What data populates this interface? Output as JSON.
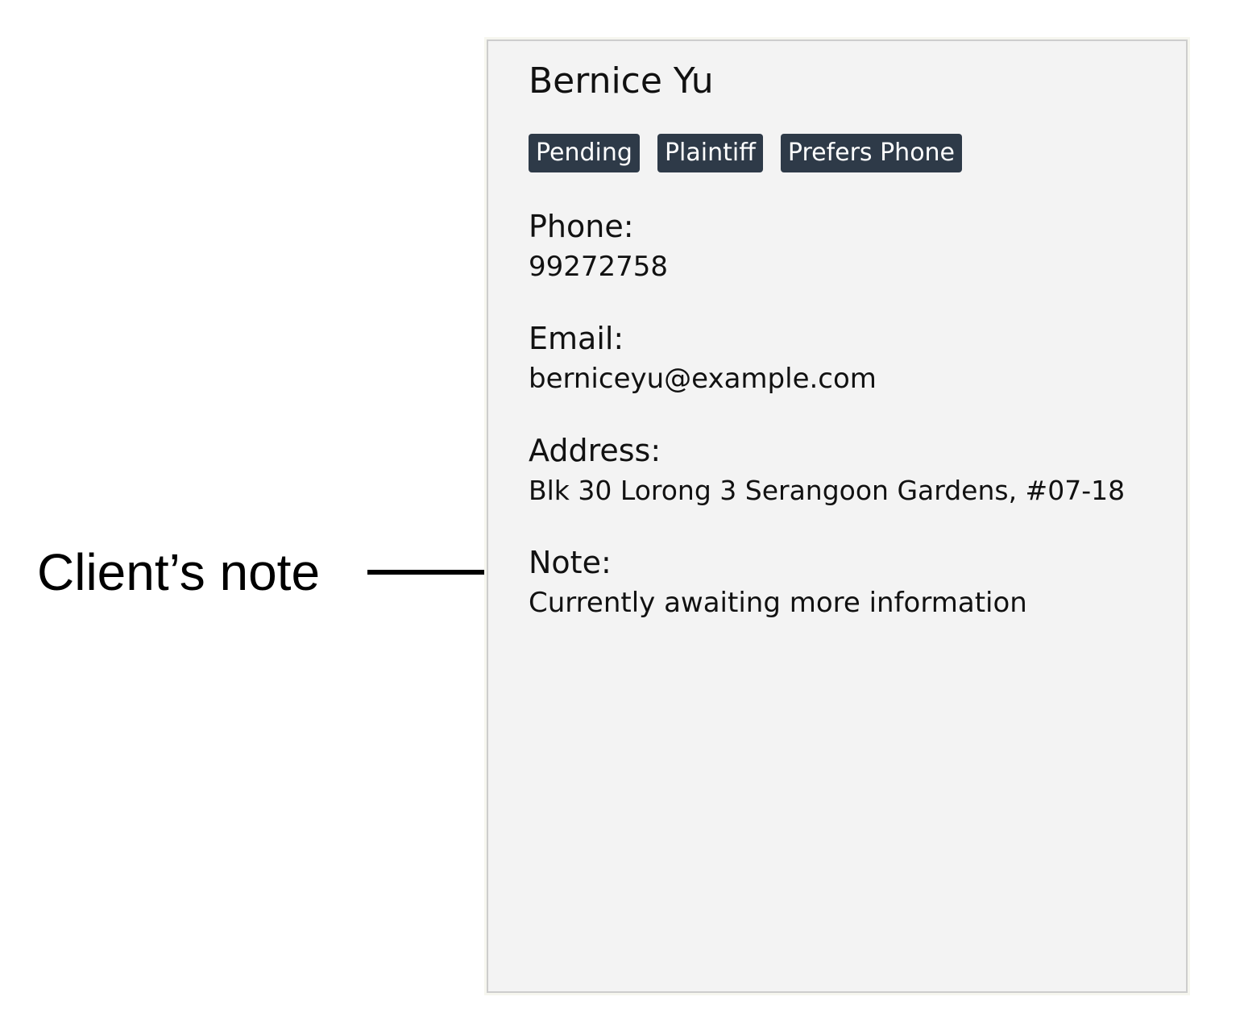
{
  "annotation": {
    "label": "Client’s note",
    "arrow_icon": "right-arrow-icon"
  },
  "person": {
    "name": "Bernice Yu",
    "tags": [
      "Pending",
      "Plaintiff",
      "Prefers Phone"
    ],
    "phone": {
      "label": "Phone:",
      "value": "99272758"
    },
    "email": {
      "label": "Email:",
      "value": "berniceyu@example.com"
    },
    "address": {
      "label": "Address:",
      "value": "Blk 30 Lorong 3 Serangoon Gardens, #07-18"
    },
    "note": {
      "label": "Note:",
      "value": "Currently awaiting more information"
    }
  },
  "colors": {
    "card_background": "#f3f3f3",
    "card_border": "#cdcdcd",
    "tag_background": "#2e3a48",
    "tag_text": "#ffffff"
  }
}
